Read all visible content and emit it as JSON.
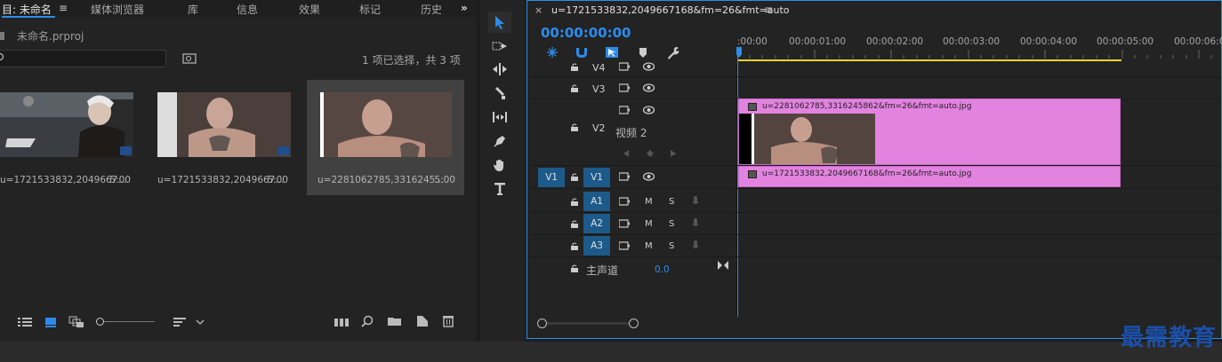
{
  "project_panel": {
    "tabs": [
      {
        "label": "目: 未命名",
        "active": true
      },
      {
        "label": "媒体浏览器",
        "active": false
      },
      {
        "label": "库",
        "active": false
      },
      {
        "label": "信息",
        "active": false
      },
      {
        "label": "效果",
        "active": false
      },
      {
        "label": "标记",
        "active": false
      },
      {
        "label": "历史",
        "active": false
      }
    ],
    "more_glyph": "»",
    "menu_glyph": "≡",
    "project_file": "未命名.prproj",
    "search": {
      "value": "",
      "placeholder": ""
    },
    "selection_status": "1 项已选择，共 3 项",
    "items": [
      {
        "name": "u=1721533832,2049667...",
        "duration": "5:00",
        "selected": false
      },
      {
        "name": "u=1721533832,2049667...",
        "duration": "5:00",
        "selected": false
      },
      {
        "name": "u=2281062785,3316245...",
        "duration": "5:00",
        "selected": true
      }
    ]
  },
  "timeline": {
    "close_glyph": "×",
    "sequence_name": "u=1721533832,2049667168&fm=26&fmt=auto",
    "menu_glyph": "≡",
    "timecode": "00:00:00:00",
    "ruler": [
      ":00:00",
      "00:00:01:00",
      "00:00:02:00",
      "00:00:03:00",
      "00:00:04:00",
      "00:00:05:00",
      "00:00:06:00"
    ],
    "video_tracks": [
      {
        "label": "V4"
      },
      {
        "label": "V3"
      },
      {
        "label": "V2",
        "name": "视频 2"
      },
      {
        "label": "V1",
        "source": "V1"
      }
    ],
    "audio_tracks": [
      {
        "label": "A1",
        "m": "M",
        "s": "S"
      },
      {
        "label": "A2",
        "m": "M",
        "s": "S"
      },
      {
        "label": "A3",
        "m": "M",
        "s": "S"
      }
    ],
    "master": {
      "label": "主声道",
      "value": "0.0"
    },
    "clips": {
      "v2": "u=2281062785,3316245862&fm=26&fmt=auto.jpg",
      "v1": "u=1721533832,2049667168&fm=26&fmt=auto.jpg"
    }
  },
  "watermark": "最需教育",
  "colors": {
    "accent": "#2d8ceb",
    "clip": "#e383e0",
    "track_badge": "#1c5a8a"
  }
}
